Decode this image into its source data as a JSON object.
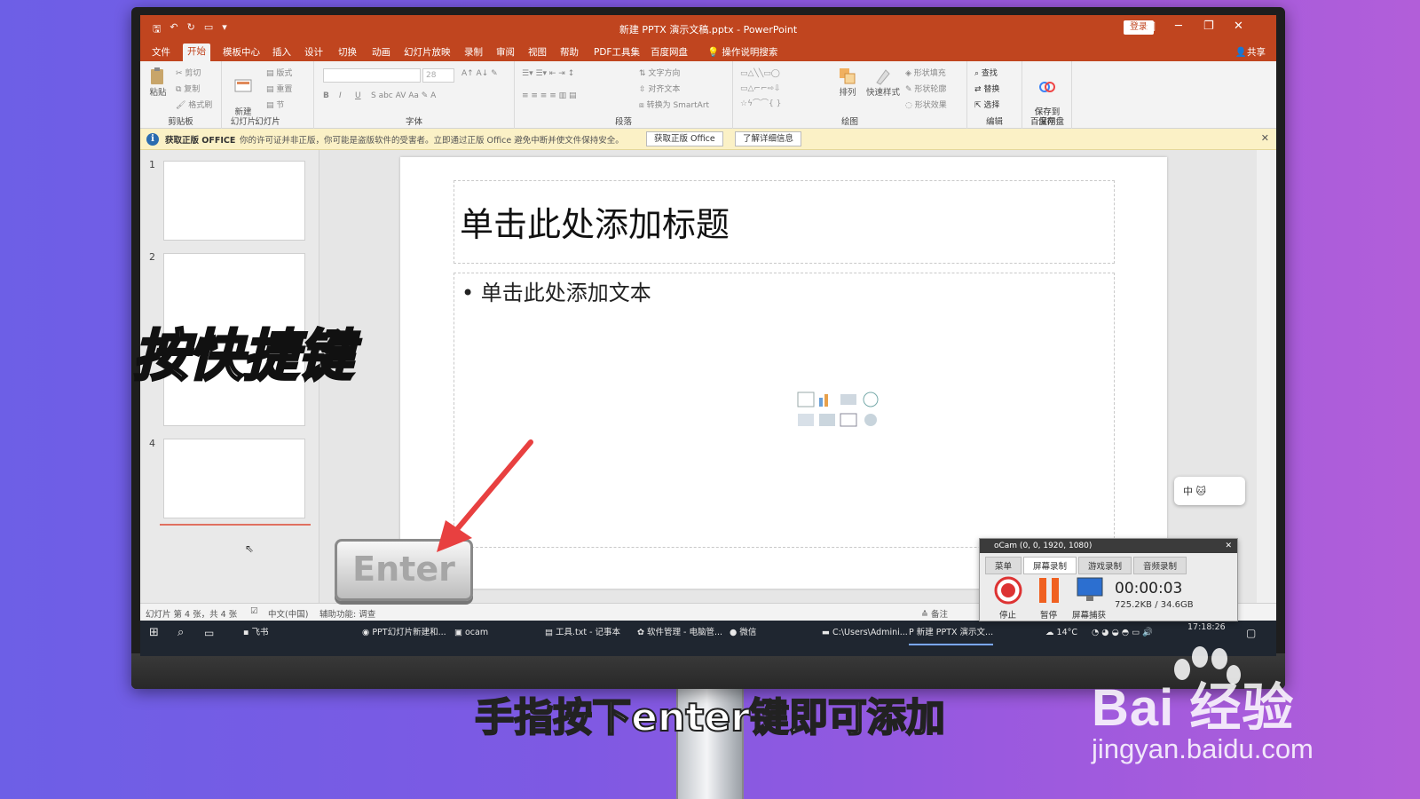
{
  "window": {
    "title": "新建 PPTX 演示文稿.pptx - PowerPoint",
    "login_label": "登录",
    "share_label": "共享"
  },
  "menu_tabs": [
    "文件",
    "开始",
    "模板中心",
    "插入",
    "设计",
    "切换",
    "动画",
    "幻灯片放映",
    "录制",
    "审阅",
    "视图",
    "帮助",
    "PDF工具集",
    "百度网盘"
  ],
  "search_hint": "操作说明搜索",
  "ribbon": {
    "clipboard": {
      "paste": "粘贴",
      "cut": "剪切",
      "copy": "复制",
      "format_painter": "格式刷",
      "label": "剪贴板"
    },
    "slides": {
      "new_slide": "新建\n幻灯片",
      "layout": "版式",
      "reset": "重置",
      "section": "节",
      "label": "幻灯片"
    },
    "font": {
      "size": "28",
      "label": "字体"
    },
    "paragraph": {
      "text_direction": "文字方向",
      "align_text": "对齐文本",
      "smartart": "转换为 SmartArt",
      "label": "段落"
    },
    "drawing": {
      "arrange": "排列",
      "quick_styles": "快速样式",
      "shape_fill": "形状填充",
      "shape_outline": "形状轮廓",
      "shape_effects": "形状效果",
      "label": "绘图"
    },
    "editing": {
      "find": "查找",
      "replace": "替换",
      "select": "选择",
      "label": "编辑"
    },
    "save": {
      "save_to": "保存到\n百度网盘",
      "label": "保存"
    }
  },
  "infobar": {
    "title": "获取正版 OFFICE",
    "message": "你的许可证并非正版，你可能是盗版软件的受害者。立即通过正版 Office 避免中断并使文件保持安全。",
    "btn_get": "获取正版 Office",
    "btn_learn": "了解详细信息"
  },
  "thumbnails": [
    {
      "num": "1"
    },
    {
      "num": "2"
    },
    {
      "num": "4"
    }
  ],
  "slide": {
    "title_placeholder": "单击此处添加标题",
    "body_placeholder": "• 单击此处添加文本"
  },
  "status": {
    "slide_info": "幻灯片 第 4 张，共 4 张",
    "language": "中文(中国)",
    "accessibility": "辅助功能: 调查",
    "notes": "备注"
  },
  "taskbar": {
    "items": [
      "飞书",
      "PPT幻灯片新建和...",
      "ocam",
      "工具.txt - 记事本",
      "软件管理 - 电脑管...",
      "微信",
      "C:\\Users\\Admini...",
      "新建 PPTX 演示文..."
    ],
    "temp": "14°C",
    "time": "17:18:26"
  },
  "ime": {
    "label": "中"
  },
  "ocam": {
    "title": "oCam (0, 0, 1920, 1080)",
    "tabs": [
      "菜单",
      "屏幕录制",
      "游戏录制",
      "音频录制"
    ],
    "stop": "停止",
    "pause": "暂停",
    "capture": "屏幕捕获",
    "time": "00:00:03",
    "size": "725.2KB / 34.6GB"
  },
  "overlay": {
    "shortcut_text": "按快捷键",
    "enter_key": "Enter",
    "subtitle": "手指按下enter键即可添加"
  },
  "watermark": {
    "brand": "Bai 经验",
    "url": "jingyan.baidu.com"
  },
  "colors": {
    "accent": "#c0451f",
    "info_bg": "#fbf1c6",
    "arrow": "#e84040"
  }
}
